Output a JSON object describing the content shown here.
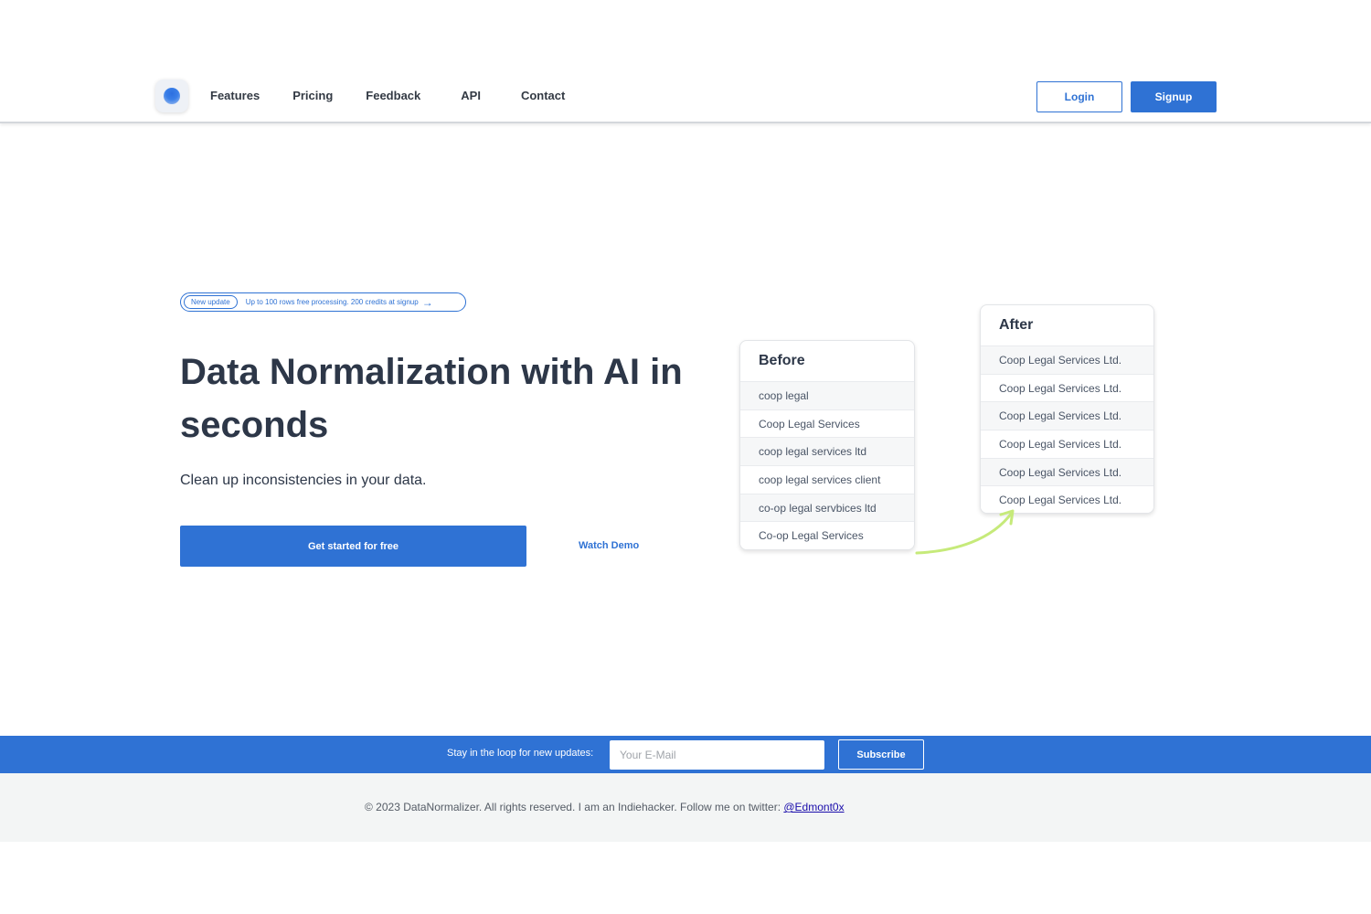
{
  "nav": {
    "logo_icon": "logo-icon",
    "links": [
      "Features",
      "Pricing",
      "Feedback",
      "API",
      "Contact"
    ],
    "login_label": "Login",
    "signup_label": "Signup"
  },
  "hero": {
    "update_tag": "New update",
    "update_text": "Up to 100 rows free processing. 200 credits at signup",
    "update_icon": "arrow-right-icon",
    "title": "Data Normalization with AI in seconds",
    "subtitle": "Clean up inconsistencies in your data.",
    "cta_label": "Get started for free",
    "demo_label": "Watch Demo"
  },
  "before": {
    "title": "Before",
    "rows": [
      "coop legal",
      "Coop Legal Services",
      "coop legal services ltd",
      "coop legal services client",
      "co-op legal servbices ltd",
      "Co-op Legal Services"
    ]
  },
  "after": {
    "title": "After",
    "rows": [
      "Coop Legal Services Ltd.",
      "Coop Legal Services Ltd.",
      "Coop Legal Services Ltd.",
      "Coop Legal Services Ltd.",
      "Coop Legal Services Ltd.",
      "Coop Legal Services Ltd."
    ]
  },
  "subscribe": {
    "label": "Stay in the loop for new updates:",
    "placeholder": "Your E-Mail",
    "button_label": "Subscribe"
  },
  "footer": {
    "text": "© 2023 DataNormalizer. All rights reserved. I am an Indiehacker. Follow me on twitter: ",
    "link_text": "@Edmont0x"
  },
  "colors": {
    "accent": "#2f72d4",
    "arrow": "#c6ea7a"
  }
}
